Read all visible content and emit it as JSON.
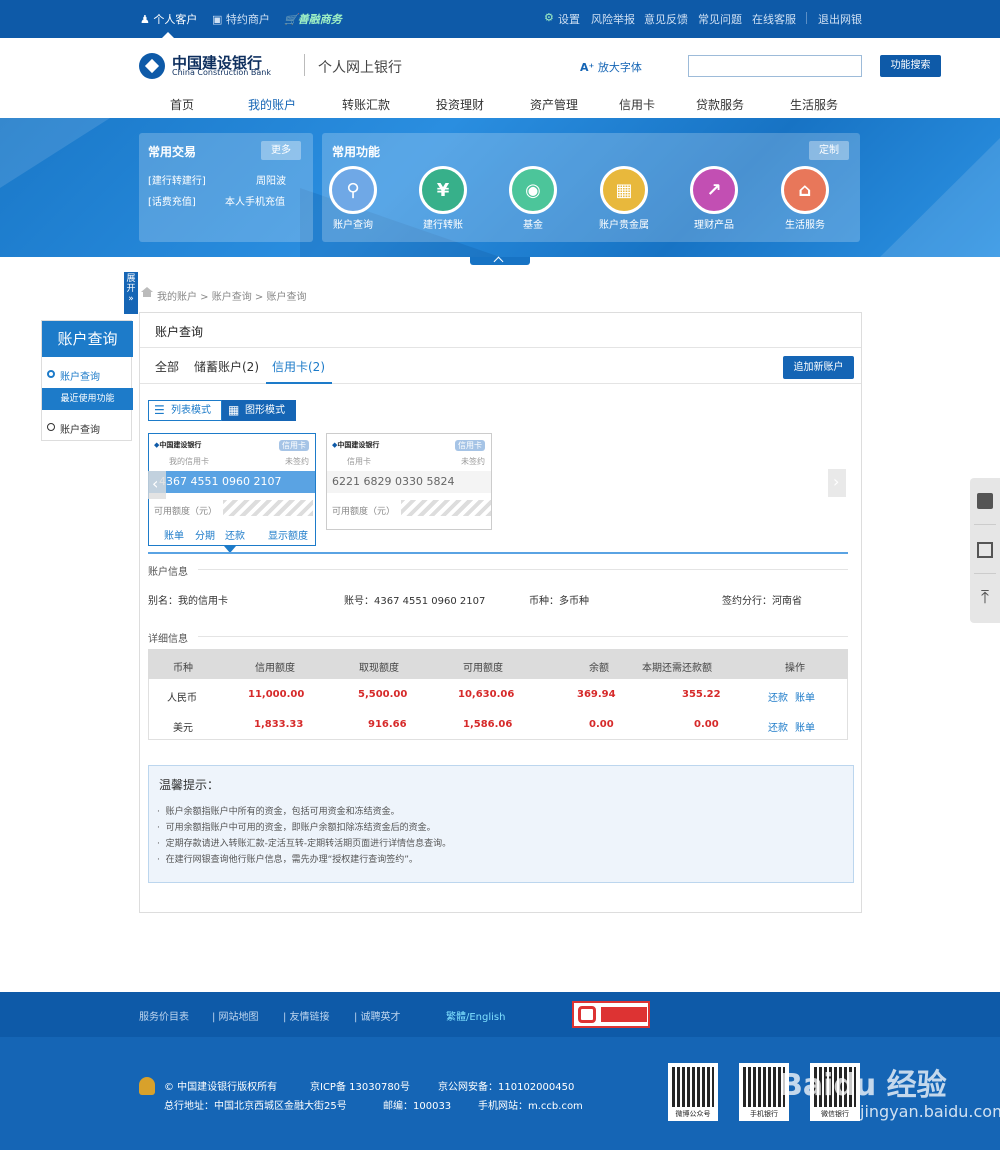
{
  "topbar": {
    "personal": "个人客户",
    "merchant": "特约商户",
    "shanrong": "善融商务",
    "settings": "设置",
    "risk": "风险举报",
    "feedback": "意见反馈",
    "faq": "常见问题",
    "online_service": "在线客服",
    "logout": "退出网银"
  },
  "header": {
    "bank_cn": "中国建设银行",
    "bank_en": "China Construction Bank",
    "site_title": "个人网上银行",
    "enlarge_font": "放大字体",
    "search_button": "功能搜索",
    "search_value": ""
  },
  "nav": [
    "首页",
    "我的账户",
    "转账汇款",
    "投资理财",
    "资产管理",
    "信用卡",
    "贷款服务",
    "生活服务"
  ],
  "banner": {
    "common_tx_title": "常用交易",
    "more": "更多",
    "quick_links": [
      "[建行转建行]",
      "周阳波",
      "[话费充值]",
      "本人手机充值"
    ],
    "common_func_title": "常用功能",
    "customize": "定制",
    "functions": [
      {
        "label": "账户查询",
        "color": "#6fa8e6"
      },
      {
        "label": "建行转账",
        "color": "#37b08a"
      },
      {
        "label": "基金",
        "color": "#4cc59a"
      },
      {
        "label": "账户贵金属",
        "color": "#e8b83c"
      },
      {
        "label": "理财产品",
        "color": "#c24fb3"
      },
      {
        "label": "生活服务",
        "color": "#e8775a"
      }
    ]
  },
  "side": {
    "expand_tab": "展开",
    "title": "账户查询",
    "item_query": "账户查询",
    "recent_title": "最近使用功能",
    "recent_item": "账户查询"
  },
  "breadcrumb": "我的账户 > 账户查询 > 账户查询",
  "main": {
    "title": "账户查询",
    "tabs": [
      "全部",
      "储蓄账户(2)",
      "信用卡(2)"
    ],
    "add_account": "追加新账户",
    "list_mode": "列表模式",
    "graph_mode": "图形模式",
    "cards": [
      {
        "bank": "中国建设银行",
        "badge": "信用卡",
        "nick": "我的信用卡",
        "status": "未签约",
        "number": "4367 4551 0960 2107",
        "avail_label": "可用额度（元）",
        "actions": [
          "账单",
          "分期",
          "还款"
        ],
        "show_limit": "显示额度"
      },
      {
        "bank": "中国建设银行",
        "badge": "信用卡",
        "nick": "信用卡",
        "status": "未签约",
        "number": "6221 6829 0330 5824",
        "avail_label": "可用额度（元）"
      }
    ],
    "account_info_label": "账户信息",
    "alias": "别名：我的信用卡",
    "account_no": "账号：4367 4551 0960 2107",
    "currency": "币种：多币种",
    "branch": "签约分行：河南省",
    "detail_label": "详细信息",
    "table": {
      "headers": [
        "币种",
        "信用额度",
        "取现额度",
        "可用额度",
        "余额",
        "本期还需还款额",
        "操作"
      ],
      "rows": [
        {
          "currency": "人民币",
          "credit": "11,000.00",
          "cash": "5,500.00",
          "avail": "10,630.06",
          "balance": "369.94",
          "due": "355.22",
          "repay": "还款",
          "bill": "账单"
        },
        {
          "currency": "美元",
          "credit": "1,833.33",
          "cash": "916.66",
          "avail": "1,586.06",
          "balance": "0.00",
          "due": "0.00",
          "repay": "还款",
          "bill": "账单"
        }
      ]
    },
    "tips": {
      "title": "温馨提示：",
      "lines": [
        "账户余额指账户中所有的资金，包括可用资金和冻结资金。",
        "可用余额指账户中可用的资金，即账户余额扣除冻结资金后的资金。",
        "定期存款请进入转账汇款-定活互转-定期转活期页面进行详情信息查询。",
        "在建行网银查询他行账户信息，需先办理“授权建行查询签约”。"
      ]
    }
  },
  "footer": {
    "links": [
      "服务价目表",
      "| 网站地图",
      "| 友情链接",
      "| 诚聘英才"
    ],
    "lang": "繁體/English",
    "copyright": "© 中国建设银行版权所有",
    "icp": "京ICP备 13030780号",
    "police": "京公网安备：110102000450",
    "address": "总行地址：中国北京西城区金融大街25号",
    "postcode": "邮编：100033",
    "mobile_site": "手机网站：m.ccb.com",
    "qr_captions": [
      "微博公众号",
      "手机银行",
      "微信银行"
    ],
    "watermark": "Baidu 经验",
    "watermark_url": "jingyan.baidu.com"
  }
}
